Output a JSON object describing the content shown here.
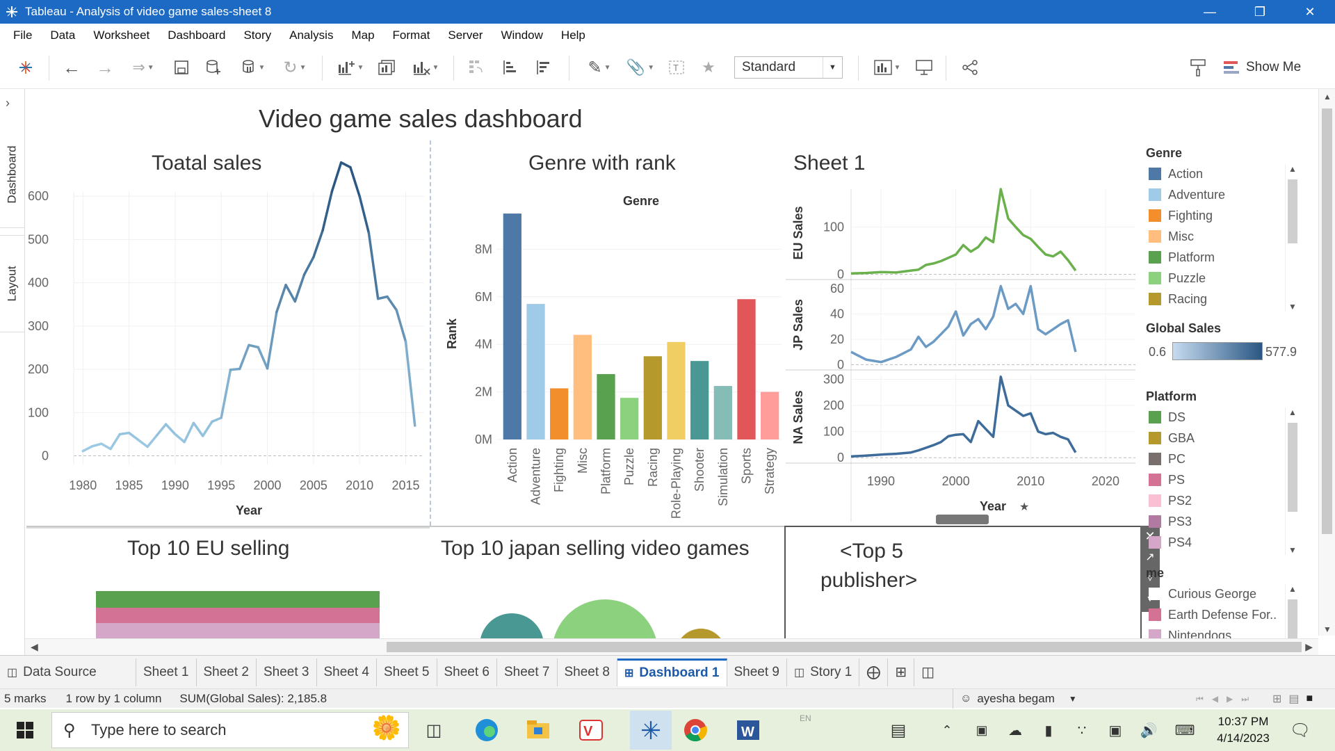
{
  "window": {
    "title": "Tableau - Analysis of video game sales-sheet 8"
  },
  "menu": [
    "File",
    "Data",
    "Worksheet",
    "Dashboard",
    "Story",
    "Analysis",
    "Map",
    "Format",
    "Server",
    "Window",
    "Help"
  ],
  "toolbar": {
    "fit_select": "Standard",
    "show_me": "Show Me"
  },
  "side_panel": {
    "tabs": [
      "Dashboard",
      "Layout"
    ]
  },
  "dashboard": {
    "title": "Video game  sales dashboard"
  },
  "colors": {
    "action": "#4e79a7",
    "adventure": "#a0cbe8",
    "fighting": "#f28e2b",
    "misc": "#ffbe7d",
    "platform": "#59a14f",
    "puzzle": "#8cd17d",
    "racing": "#b6992d",
    "roleplaying": "#f1ce63",
    "shooter": "#499894",
    "simulation": "#86bcb6",
    "sports": "#e15759",
    "strategy": "#ff9d9a",
    "accent": "#1c6ac4",
    "taskbar": "#e6f0dc"
  },
  "chart_data": [
    {
      "type": "line",
      "title": "Toatal sales",
      "xlabel": "Year",
      "ylabel": "",
      "x": [
        1980,
        1981,
        1982,
        1983,
        1984,
        1985,
        1986,
        1987,
        1988,
        1989,
        1990,
        1991,
        1992,
        1993,
        1994,
        1995,
        1996,
        1997,
        1998,
        1999,
        2000,
        2001,
        2002,
        2003,
        2004,
        2005,
        2006,
        2007,
        2008,
        2009,
        2010,
        2011,
        2012,
        2013,
        2014,
        2015,
        2016
      ],
      "values": [
        11,
        22,
        28,
        16,
        50,
        53,
        37,
        21,
        47,
        73,
        50,
        32,
        76,
        46,
        79,
        88,
        199,
        201,
        256,
        251,
        202,
        332,
        395,
        357,
        419,
        459,
        521,
        611,
        678,
        667,
        600,
        515,
        363,
        368,
        337,
        264,
        70
      ],
      "xlim": [
        1979,
        2017
      ],
      "ylim": [
        -20,
        610
      ],
      "xticks": [
        1980,
        1985,
        1990,
        1995,
        2000,
        2005,
        2010,
        2015
      ],
      "yticks": [
        0,
        100,
        200,
        300,
        400,
        500,
        600
      ]
    },
    {
      "type": "bar",
      "title": "Genre with rank",
      "subtitle": "Genre",
      "xlabel": "",
      "ylabel": "Rank",
      "categories": [
        "Action",
        "Adventure",
        "Fighting",
        "Misc",
        "Platform",
        "Puzzle",
        "Racing",
        "Role-Playing",
        "Shooter",
        "Simulation",
        "Sports",
        "Strategy"
      ],
      "values": [
        9500000,
        5700000,
        2150000,
        4400000,
        2750000,
        1750000,
        3500000,
        4100000,
        3300000,
        2250000,
        5900000,
        2000000
      ],
      "ylim": [
        0,
        10000000
      ],
      "yticks": [
        0,
        2000000,
        4000000,
        6000000,
        8000000
      ],
      "ytick_labels": [
        "0M",
        "2M",
        "4M",
        "6M",
        "8M"
      ]
    },
    {
      "type": "line",
      "title": "Sheet 1",
      "xlabel": "Year",
      "xlim": [
        1986,
        2024
      ],
      "xticks": [
        1990,
        2000,
        2010,
        2020
      ],
      "panels": [
        {
          "name": "EU Sales",
          "color": "#6ab04c",
          "ylim": [
            -5,
            180
          ],
          "yticks": [
            0,
            100
          ],
          "x": [
            1986,
            1988,
            1990,
            1992,
            1994,
            1995,
            1996,
            1997,
            1998,
            1999,
            2000,
            2001,
            2002,
            2003,
            2004,
            2005,
            2006,
            2007,
            2008,
            2009,
            2010,
            2011,
            2012,
            2013,
            2014,
            2015,
            2016
          ],
          "values": [
            2,
            3,
            5,
            4,
            8,
            10,
            20,
            23,
            28,
            35,
            42,
            62,
            48,
            58,
            78,
            68,
            180,
            118,
            100,
            83,
            75,
            58,
            42,
            38,
            48,
            30,
            8
          ]
        },
        {
          "name": "JP Sales",
          "color": "#6b9ac4",
          "ylim": [
            -2,
            65
          ],
          "yticks": [
            0,
            20,
            40,
            60
          ],
          "x": [
            1986,
            1988,
            1990,
            1992,
            1994,
            1995,
            1996,
            1997,
            1998,
            1999,
            2000,
            2001,
            2002,
            2003,
            2004,
            2005,
            2006,
            2007,
            2008,
            2009,
            2010,
            2011,
            2012,
            2013,
            2014,
            2015,
            2016
          ],
          "values": [
            10,
            4,
            2,
            6,
            12,
            22,
            14,
            18,
            24,
            30,
            42,
            23,
            32,
            36,
            28,
            38,
            62,
            44,
            48,
            40,
            62,
            28,
            24,
            28,
            32,
            35,
            10
          ]
        },
        {
          "name": "NA Sales",
          "color": "#3d6c9a",
          "ylim": [
            -10,
            320
          ],
          "yticks": [
            0,
            100,
            200,
            300
          ],
          "x": [
            1986,
            1988,
            1990,
            1992,
            1994,
            1995,
            1996,
            1997,
            1998,
            1999,
            2000,
            2001,
            2002,
            2003,
            2004,
            2005,
            2006,
            2007,
            2008,
            2009,
            2010,
            2011,
            2012,
            2013,
            2014,
            2015,
            2016
          ],
          "values": [
            5,
            8,
            12,
            15,
            20,
            28,
            38,
            48,
            60,
            82,
            88,
            90,
            60,
            140,
            110,
            80,
            310,
            200,
            180,
            160,
            170,
            100,
            90,
            95,
            80,
            70,
            20
          ]
        }
      ]
    }
  ],
  "bottom_panels": {
    "eu_title": "Top 10 EU selling",
    "jp_title": "Top 10 japan selling video games",
    "publisher_line1": "<Top 5",
    "publisher_line2": "publisher>"
  },
  "legends": {
    "genre_title": "Genre",
    "genre_items": [
      {
        "label": "Action",
        "color": "#4e79a7"
      },
      {
        "label": "Adventure",
        "color": "#a0cbe8"
      },
      {
        "label": "Fighting",
        "color": "#f28e2b"
      },
      {
        "label": "Misc",
        "color": "#ffbe7d"
      },
      {
        "label": "Platform",
        "color": "#59a14f"
      },
      {
        "label": "Puzzle",
        "color": "#8cd17d"
      },
      {
        "label": "Racing",
        "color": "#b6992d"
      }
    ],
    "global_sales_title": "Global Sales",
    "global_sales_min": "0.6",
    "global_sales_max": "577.9",
    "platform_title": "Platform",
    "platform_items": [
      {
        "label": "DS",
        "color": "#59a14f"
      },
      {
        "label": "GBA",
        "color": "#b6992d"
      },
      {
        "label": "PC",
        "color": "#79706e"
      },
      {
        "label": "PS",
        "color": "#d37295"
      },
      {
        "label": "PS2",
        "color": "#fabfd2"
      },
      {
        "label": "PS3",
        "color": "#b07aa1"
      },
      {
        "label": "PS4",
        "color": "#d4a6c8"
      }
    ],
    "name_title": "me",
    "name_items": [
      {
        "label": "Curious George",
        "color": "#ffffff"
      },
      {
        "label": "Earth Defense For..",
        "color": "#d37295"
      },
      {
        "label": "Nintendogs",
        "color": "#d4a6c8"
      }
    ]
  },
  "sheet_tabs": [
    "Data Source",
    "Sheet 1",
    "Sheet 2",
    "Sheet 3",
    "Sheet 4",
    "Sheet 5",
    "Sheet 6",
    "Sheet 7",
    "Sheet 8",
    "Dashboard 1",
    "Sheet 9",
    "Story 1"
  ],
  "active_tab": "Dashboard 1",
  "status": {
    "marks": "5 marks",
    "rows_cols": "1 row by 1 column",
    "sum": "SUM(Global Sales): 2,185.8",
    "user": "ayesha begam"
  },
  "taskbar": {
    "search_placeholder": "Type here to search",
    "time": "10:37 PM",
    "date": "4/14/2023",
    "lang": "EN"
  }
}
